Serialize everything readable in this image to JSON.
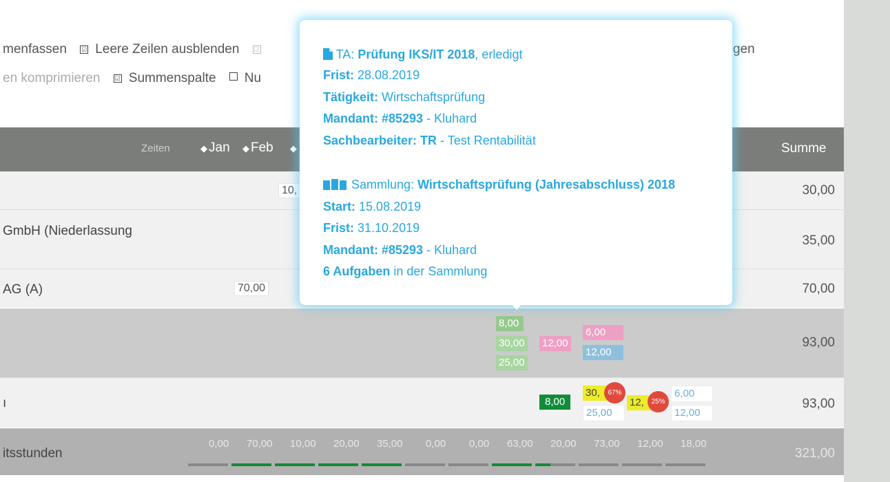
{
  "options": {
    "line1": [
      {
        "label": "menfassen",
        "checked": null,
        "faded": false
      },
      {
        "label": "Leere Zeilen ausblenden",
        "checked": true,
        "faded": false
      },
      {
        "label": "",
        "checked": true,
        "faded": true
      },
      {
        "label": "gen",
        "checked": null,
        "faded": false
      }
    ],
    "line2": [
      {
        "label": "en komprimieren",
        "checked": null,
        "faded": true
      },
      {
        "label": "Summenspalte",
        "checked": true,
        "faded": false
      },
      {
        "label": "Nu",
        "checked": false,
        "faded": false
      }
    ]
  },
  "header": {
    "zeiten": "Zeiten",
    "jan": "Jan",
    "feb": "Feb",
    "summe": "Summe"
  },
  "rows": [
    {
      "label": "",
      "sum": "30,00",
      "cell": "10,"
    },
    {
      "label": "GmbH (Niederlassung",
      "sum": "35,00"
    },
    {
      "label": "AG (A)",
      "sum": "70,00",
      "cell": "70,00"
    },
    {
      "label": "",
      "sum": "93,00",
      "tags": {
        "a": "8,00",
        "b": "30,00",
        "c": "25,00",
        "d": "12,00",
        "e": "6,00",
        "f": "12,00"
      }
    },
    {
      "label": "ı",
      "sum": "93,00",
      "tags": {
        "a": "8,00",
        "b": "30,",
        "b_badge": "67%",
        "c": "25,00",
        "d": "12,",
        "d_badge": "25%",
        "e": "6,00",
        "f": "12,00"
      }
    },
    {
      "label": "itsstunden",
      "sum": "321,00"
    }
  ],
  "totals": [
    "0,00",
    "70,00",
    "10,00",
    "20,00",
    "35,00",
    "0,00",
    "0,00",
    "63,00",
    "20,00",
    "73,00",
    "12,00",
    "18,00"
  ],
  "totals_bar_fill": [
    "none",
    "full",
    "full",
    "full",
    "full",
    "none",
    "none",
    "full",
    "partial",
    "none",
    "none",
    "none"
  ],
  "popover": {
    "task_prefix": "TA:",
    "task_name": "Prüfung IKS/IT 2018",
    "task_status": ", erledigt",
    "frist_label": "Frist:",
    "frist_value": "28.08.2019",
    "taetigkeit_label": "Tätigkeit:",
    "taetigkeit_value": "Wirtschaftsprüfung",
    "mandant_label": "Mandant: #85293",
    "mandant_value": "- Kluhard",
    "sb_label": "Sachbearbeiter: TR",
    "sb_value": "- Test Rentabilität",
    "coll_prefix": "Sammlung:",
    "coll_name": "Wirtschaftsprüfung (Jahresabschluss) 2018",
    "start_label": "Start:",
    "start_value": "15.08.2019",
    "frist2_label": "Frist:",
    "frist2_value": "31.10.2019",
    "mandant2_label": "Mandant: #85293",
    "mandant2_value": "- Kluhard",
    "count_label": "6 Aufgaben",
    "count_value": "in der Sammlung"
  },
  "icons": [
    "document-icon",
    "collection-icon"
  ]
}
